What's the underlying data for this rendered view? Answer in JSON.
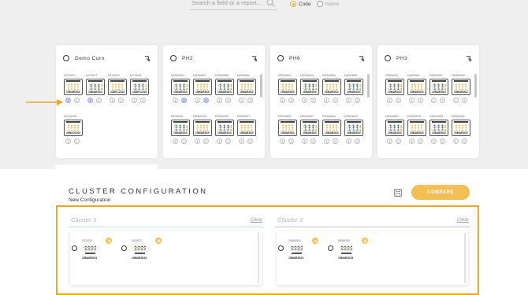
{
  "search": {
    "placeholder": "Search a field or a report...",
    "mode_options": [
      {
        "label": "Code",
        "selected": true
      },
      {
        "label": "Name",
        "selected": false
      }
    ]
  },
  "colors": {
    "accent": "#f3bf55",
    "highlight_border": "#f0a52a",
    "background": "#efefef"
  },
  "fields": [
    {
      "title": "Demo Corn",
      "has_scrollbar": false,
      "thumbs": [
        {
          "code": "DC0020",
          "foot": "15MAR2024",
          "badges": [
            "1",
            "2"
          ],
          "active": [
            true,
            false
          ]
        },
        {
          "code": "DC0027",
          "foot": "15MAR2024",
          "badges": [
            "1",
            "2"
          ],
          "active": [
            true,
            false
          ]
        },
        {
          "code": "DC0029",
          "foot": "23DEC2023",
          "badges": [
            "1",
            "2"
          ],
          "active": [
            false,
            false
          ]
        },
        {
          "code": "DC0024",
          "foot": "23DEC2023",
          "badges": [
            "1",
            "2"
          ],
          "active": [
            false,
            false
          ]
        },
        {
          "code": "DC0029F",
          "foot": "26NOV2023",
          "badges": [
            "1",
            "2"
          ],
          "active": [
            false,
            false
          ]
        }
      ]
    },
    {
      "title": "PH2",
      "has_scrollbar": true,
      "thumbs": [
        {
          "code": "DE6000U",
          "foot": "15MAR2023",
          "badges": [
            "1",
            "2"
          ],
          "active": [
            false,
            true
          ]
        },
        {
          "code": "DE6000X",
          "foot": "15MAR2023",
          "badges": [
            "1",
            "2"
          ],
          "active": [
            false,
            true
          ]
        },
        {
          "code": "DE6000B",
          "foot": "15MAR2023",
          "badges": [
            "1",
            "2"
          ],
          "active": [
            false,
            false
          ]
        },
        {
          "code": "DE6006L",
          "foot": "15MAR2023",
          "badges": [
            "1",
            "2"
          ],
          "active": [
            false,
            false
          ]
        },
        {
          "code": "DE6000I",
          "foot": "15MAR2023",
          "badges": [
            "1",
            "2"
          ],
          "active": [
            false,
            false
          ]
        },
        {
          "code": "DE6000A",
          "foot": "15MAR2023",
          "badges": [
            "1",
            "2"
          ],
          "active": [
            false,
            false
          ]
        },
        {
          "code": "DE6000R",
          "foot": "15MAR2023",
          "badges": [
            "1",
            "2"
          ],
          "active": [
            false,
            false
          ]
        },
        {
          "code": "DE6000T",
          "foot": "15MAR2023",
          "badges": [
            "1",
            "2"
          ],
          "active": [
            false,
            false
          ]
        }
      ]
    },
    {
      "title": "PH6",
      "has_scrollbar": true,
      "thumbs": [
        {
          "code": "DE6060J",
          "foot": "15MAR2023",
          "badges": [
            "1",
            "2"
          ],
          "active": [
            false,
            false
          ]
        },
        {
          "code": "DE6060Q",
          "foot": "15MAR2023",
          "badges": [
            "1",
            "2"
          ],
          "active": [
            false,
            false
          ]
        },
        {
          "code": "DE6060N",
          "foot": "15MAR2023",
          "badges": [
            "1",
            "2"
          ],
          "active": [
            false,
            false
          ]
        },
        {
          "code": "DE6060K",
          "foot": "15MAR2023",
          "badges": [
            "1",
            "2"
          ],
          "active": [
            false,
            false
          ]
        },
        {
          "code": "DE6060E",
          "foot": "15MAR2023",
          "badges": [
            "1",
            "2"
          ],
          "active": [
            false,
            false
          ]
        },
        {
          "code": "DE6060P",
          "foot": "15MAR2023",
          "badges": [
            "1",
            "2"
          ],
          "active": [
            false,
            false
          ]
        },
        {
          "code": "DE6060U",
          "foot": "15MAR2023",
          "badges": [
            "1",
            "2"
          ],
          "active": [
            false,
            false
          ]
        },
        {
          "code": "DE6060C",
          "foot": "15MAR2023",
          "badges": [
            "1",
            "2"
          ],
          "active": [
            false,
            false
          ]
        }
      ]
    },
    {
      "title": "PH3",
      "has_scrollbar": true,
      "thumbs": [
        {
          "code": "DE6000J",
          "foot": "15MAR2023",
          "badges": [
            "1",
            "2"
          ],
          "active": [
            false,
            false
          ]
        },
        {
          "code": "DE6000I",
          "foot": "15MAR2023",
          "badges": [
            "1",
            "2"
          ],
          "active": [
            false,
            false
          ]
        },
        {
          "code": "DE6000E",
          "foot": "15MAR2023",
          "badges": [
            "1",
            "2"
          ],
          "active": [
            false,
            false
          ]
        },
        {
          "code": "DE6000B",
          "foot": "15MAR2023",
          "badges": [
            "1",
            "2"
          ],
          "active": [
            false,
            false
          ]
        },
        {
          "code": "DE6000C",
          "foot": "15MAR2023",
          "badges": [
            "1",
            "2"
          ],
          "active": [
            false,
            false
          ]
        },
        {
          "code": "DE6000S",
          "foot": "15MAR2023",
          "badges": [
            "1",
            "2"
          ],
          "active": [
            false,
            false
          ]
        },
        {
          "code": "DE6000B",
          "foot": "15MAR2023",
          "badges": [
            "1",
            "2"
          ],
          "active": [
            false,
            false
          ]
        },
        {
          "code": "DE6000Z",
          "foot": "15MAR2023",
          "badges": [
            "1",
            "2"
          ],
          "active": [
            false,
            false
          ]
        }
      ]
    }
  ],
  "cluster_config": {
    "title": "CLUSTER CONFIGURATION",
    "subtitle": "New Configuration",
    "compare_label": "COMPARE",
    "clusters": [
      {
        "name": "Cluster 1",
        "clear_label": "Clear",
        "line_color": "#b9dfe4",
        "items": [
          {
            "code": "DC0020",
            "foot": "15MAR2024"
          },
          {
            "code": "DC0027",
            "foot": "15MAR2024"
          }
        ]
      },
      {
        "name": "Cluster 2",
        "clear_label": "Clear",
        "line_color": "#c9c3e2",
        "items": [
          {
            "code": "DE6000U",
            "foot": "15MAR2023"
          },
          {
            "code": "DE6000X",
            "foot": "15MAR2023"
          }
        ]
      }
    ]
  }
}
